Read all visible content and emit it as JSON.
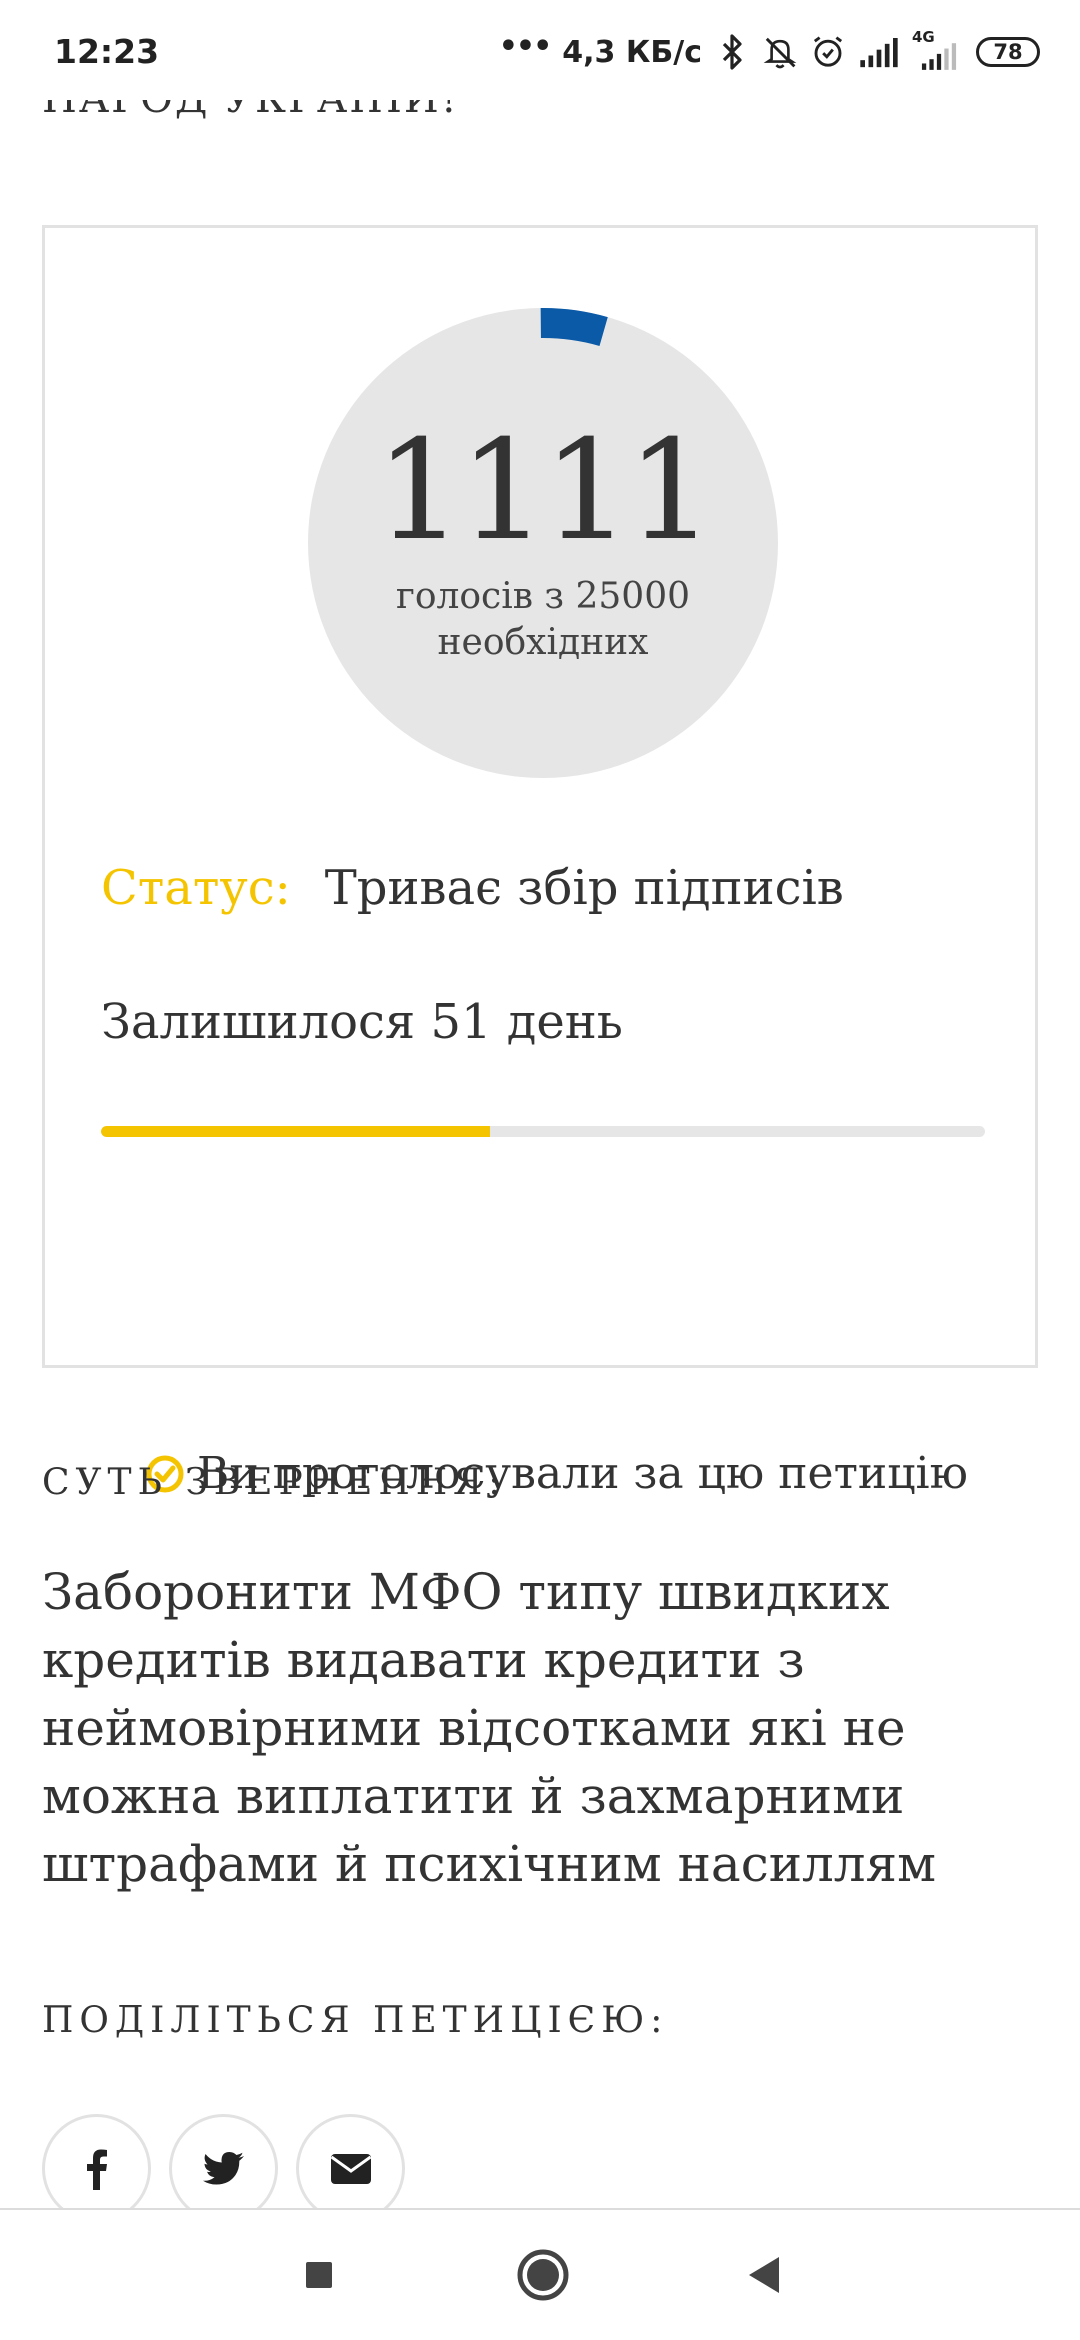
{
  "status_bar": {
    "time": "12:23",
    "dots": "•••",
    "net_speed": "4,3 КБ/с",
    "battery": "78",
    "network_type": "4G",
    "icons": [
      "bluetooth-icon",
      "muted-bell-icon",
      "alarm-icon",
      "signal-icon",
      "signal-4g-icon",
      "battery-icon"
    ]
  },
  "page": {
    "cut_heading": "НАРОД УКРАЇНИ!"
  },
  "vote_card": {
    "count": "1111",
    "caption_line1": "голосів з 25000",
    "caption_line2": "необхідних",
    "votes_current": 1111,
    "votes_needed": 25000,
    "status_label": "Статус:",
    "status_value": "Триває збір підписів",
    "days_left": "Залишилося 51 день",
    "deadline_progress": 0.44,
    "voted_text": "Ви проголосували за цю петицію",
    "colors": {
      "accent_yellow": "#f5c400",
      "ring_blue": "#0a5aa8",
      "ring_bg": "#e6e6e6"
    }
  },
  "summary": {
    "label": "СУТЬ ЗВЕРНЕННЯ:",
    "text": "Заборонити МФО типу швидких кредитів видавати кредити з неймовірними відсотками які не можна виплатити й захмарними штрафами й психічним насиллям"
  },
  "share": {
    "label": "ПОДІЛІТЬСЯ ПЕТИЦІЄЮ:",
    "buttons": [
      "facebook-icon",
      "twitter-icon",
      "email-icon"
    ]
  },
  "nav_bar": {
    "buttons": [
      "recent-apps-icon",
      "home-icon",
      "back-icon"
    ]
  }
}
